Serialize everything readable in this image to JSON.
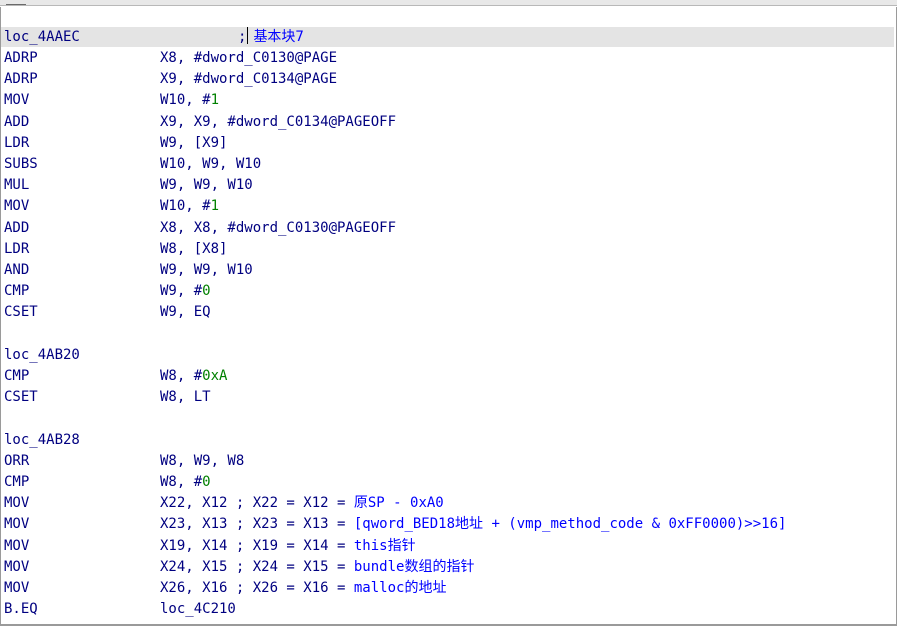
{
  "window": {
    "colors": {
      "text": "#000080",
      "comment": "#0000ff",
      "number": "#008000",
      "highlight": "#e4e4e4"
    }
  },
  "listing": {
    "header": {
      "label": "loc_4AAEC",
      "comment_semicolon": ";",
      "comment": "基本块7"
    },
    "lines": [
      {
        "m": "ADRP",
        "ops": [
          {
            "t": "X8, #dword_C0130@PAGE"
          }
        ]
      },
      {
        "m": "ADRP",
        "ops": [
          {
            "t": "X9, #dword_C0134@PAGE"
          }
        ]
      },
      {
        "m": "MOV",
        "ops": [
          {
            "t": "W10, #"
          },
          {
            "t": "1",
            "num": true
          }
        ]
      },
      {
        "m": "ADD",
        "ops": [
          {
            "t": "X9, X9, #dword_C0134@PAGEOFF"
          }
        ]
      },
      {
        "m": "LDR",
        "ops": [
          {
            "t": "W9, [X9]"
          }
        ]
      },
      {
        "m": "SUBS",
        "ops": [
          {
            "t": "W10, W9, W10"
          }
        ]
      },
      {
        "m": "MUL",
        "ops": [
          {
            "t": "W9, W9, W10"
          }
        ]
      },
      {
        "m": "MOV",
        "ops": [
          {
            "t": "W10, #"
          },
          {
            "t": "1",
            "num": true
          }
        ]
      },
      {
        "m": "ADD",
        "ops": [
          {
            "t": "X8, X8, #dword_C0130@PAGEOFF"
          }
        ]
      },
      {
        "m": "LDR",
        "ops": [
          {
            "t": "W8, [X8]"
          }
        ]
      },
      {
        "m": "AND",
        "ops": [
          {
            "t": "W9, W9, W10"
          }
        ]
      },
      {
        "m": "CMP",
        "ops": [
          {
            "t": "W9, #"
          },
          {
            "t": "0",
            "num": true
          }
        ]
      },
      {
        "m": "CSET",
        "ops": [
          {
            "t": "W9, EQ"
          }
        ]
      },
      {
        "blank": true
      },
      {
        "label": "loc_4AB20"
      },
      {
        "m": "CMP",
        "ops": [
          {
            "t": "W8, #"
          },
          {
            "t": "0xA",
            "num": true
          }
        ]
      },
      {
        "m": "CSET",
        "ops": [
          {
            "t": "W8, LT"
          }
        ]
      },
      {
        "blank": true
      },
      {
        "label": "loc_4AB28"
      },
      {
        "m": "ORR",
        "ops": [
          {
            "t": "W8, W9, W8"
          }
        ]
      },
      {
        "m": "CMP",
        "ops": [
          {
            "t": "W8, #"
          },
          {
            "t": "0",
            "num": true
          }
        ]
      },
      {
        "m": "MOV",
        "ops": [
          {
            "t": "X22, X12 ; X22 = X12 = "
          },
          {
            "t": "原SP - 0xA0",
            "cm": true
          }
        ]
      },
      {
        "m": "MOV",
        "ops": [
          {
            "t": "X23, X13 ; X23 = X13 = "
          },
          {
            "t": "[qword_BED18地址 + (vmp_method_code & 0xFF0000)>>16]",
            "cm": true
          }
        ]
      },
      {
        "m": "MOV",
        "ops": [
          {
            "t": "X19, X14 ; X19 = X14 = "
          },
          {
            "t": "this指针",
            "cm": true
          }
        ]
      },
      {
        "m": "MOV",
        "ops": [
          {
            "t": "X24, X15 ; X24 = X15 = "
          },
          {
            "t": "bundle数组的指针",
            "cm": true
          }
        ]
      },
      {
        "m": "MOV",
        "ops": [
          {
            "t": "X26, X16 ; X26 = X16 = "
          },
          {
            "t": "malloc的地址",
            "cm": true
          }
        ]
      },
      {
        "m": "B.EQ",
        "ops": [
          {
            "t": "loc_4C210"
          }
        ]
      }
    ]
  }
}
